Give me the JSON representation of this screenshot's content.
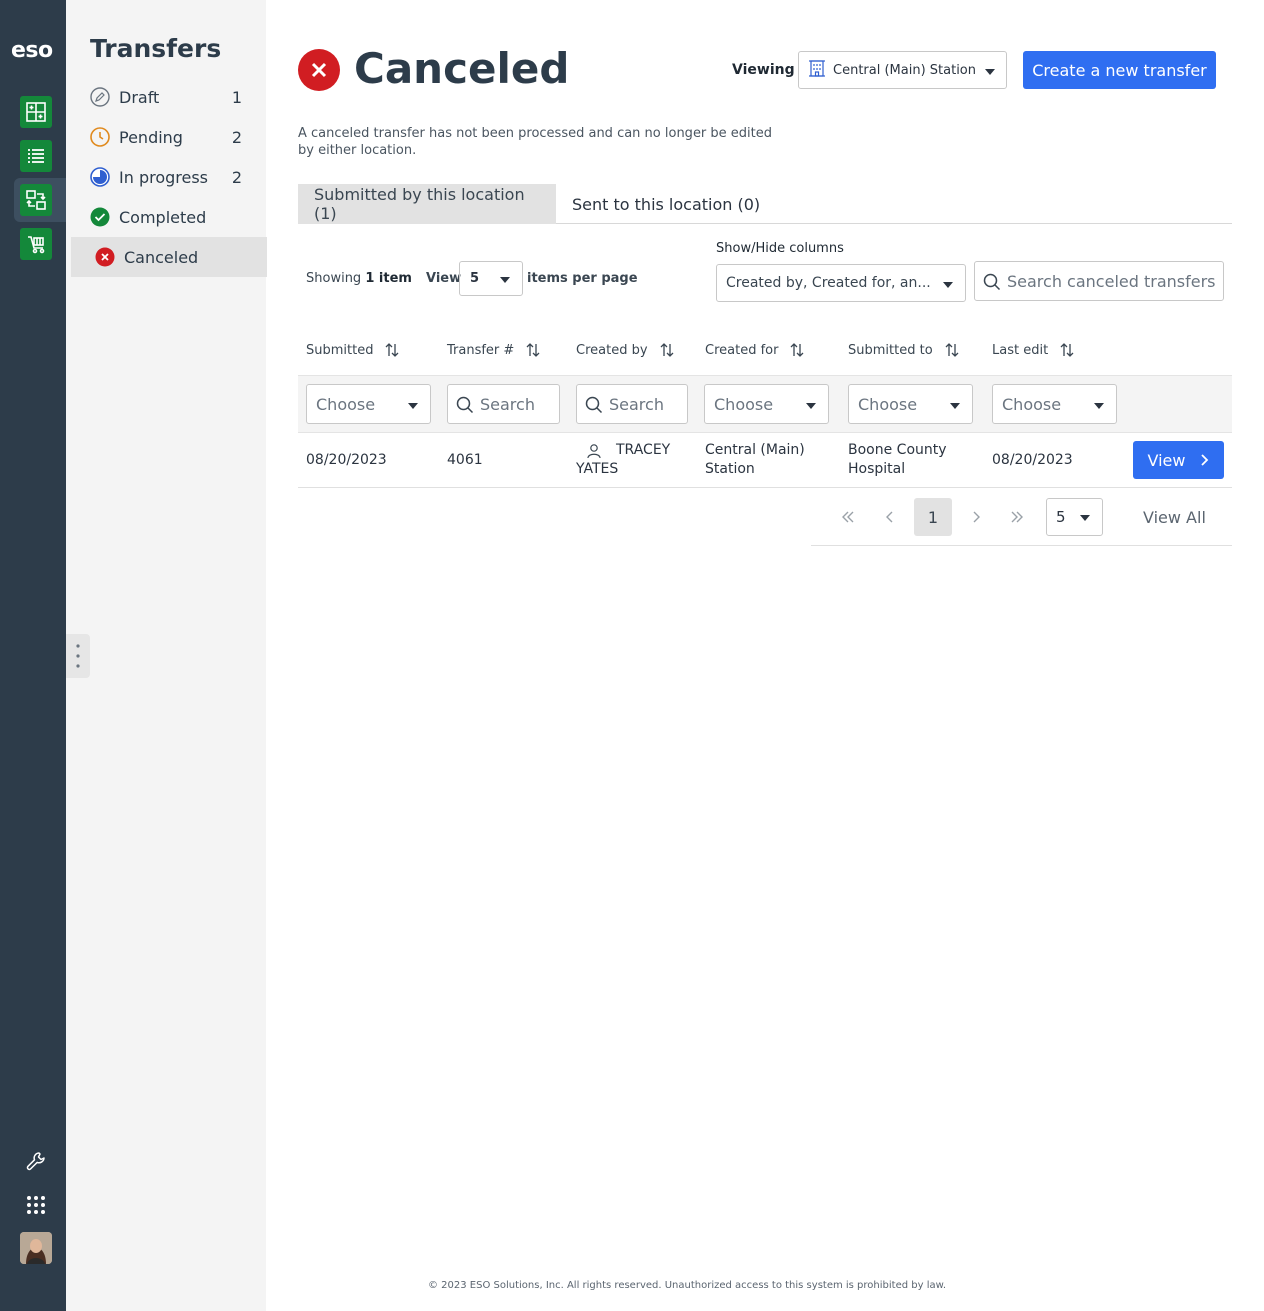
{
  "app": {
    "logo": "eso",
    "rail_icons": [
      "dashboard-grid-icon",
      "list-icon",
      "transfers-icon",
      "cart-icon"
    ],
    "rail_bottom_icons": [
      "wrench-icon",
      "apps-grid-icon",
      "user-avatar"
    ]
  },
  "sidebar": {
    "title": "Transfers",
    "items": [
      {
        "label": "Draft",
        "count": "1",
        "icon": "pencil-circle-icon"
      },
      {
        "label": "Pending",
        "count": "2",
        "icon": "clock-icon"
      },
      {
        "label": "In progress",
        "count": "2",
        "icon": "progress-circle-icon"
      },
      {
        "label": "Completed",
        "count": "",
        "icon": "check-circle-icon"
      },
      {
        "label": "Canceled",
        "count": "",
        "icon": "x-circle-icon",
        "active": true
      }
    ]
  },
  "header": {
    "title": "Canceled",
    "viewing_label": "Viewing",
    "station": "Central (Main) Station",
    "create_button": "Create a new transfer",
    "description": "A canceled transfer has not been processed and can no longer be edited by either location."
  },
  "tabs": [
    {
      "label": "Submitted by this location (1)",
      "active": true
    },
    {
      "label": "Sent to this location (0)",
      "active": false
    }
  ],
  "toolbar": {
    "showing_prefix": "Showing",
    "showing_count": "1 item",
    "view_label": "View",
    "per_page": "5",
    "items_per_page": "items per page",
    "show_hide_label": "Show/Hide columns",
    "columns_value": "Created by, Created for, an...",
    "search_placeholder": "Search canceled transfers"
  },
  "table": {
    "columns": [
      "Submitted",
      "Transfer #",
      "Created by",
      "Created for",
      "Submitted to",
      "Last edit"
    ],
    "filters": [
      "Choose",
      "Search",
      "Search",
      "Choose",
      "Choose",
      "Choose"
    ],
    "rows": [
      {
        "submitted": "08/20/2023",
        "transfer_no": "4061",
        "created_by_1": "TRACEY",
        "created_by_2": "YATES",
        "created_for_1": "Central (Main)",
        "created_for_2": "Station",
        "submitted_to_1": "Boone County",
        "submitted_to_2": "Hospital",
        "last_edit": "08/20/2023",
        "action": "View"
      }
    ]
  },
  "pager": {
    "current_page": "1",
    "page_size": "5",
    "view_all": "View All"
  },
  "footer": "© 2023 ESO Solutions, Inc. All rights reserved. Unauthorized access to this system is prohibited by law.",
  "colors": {
    "rail_bg": "#2d3c4a",
    "rail_green": "#14883a",
    "primary_blue": "#2f6ef1",
    "cancel_red": "#d11d22",
    "pending_orange": "#e08a1e",
    "progress_blue": "#2f5fd0",
    "completed_green": "#14883a"
  }
}
